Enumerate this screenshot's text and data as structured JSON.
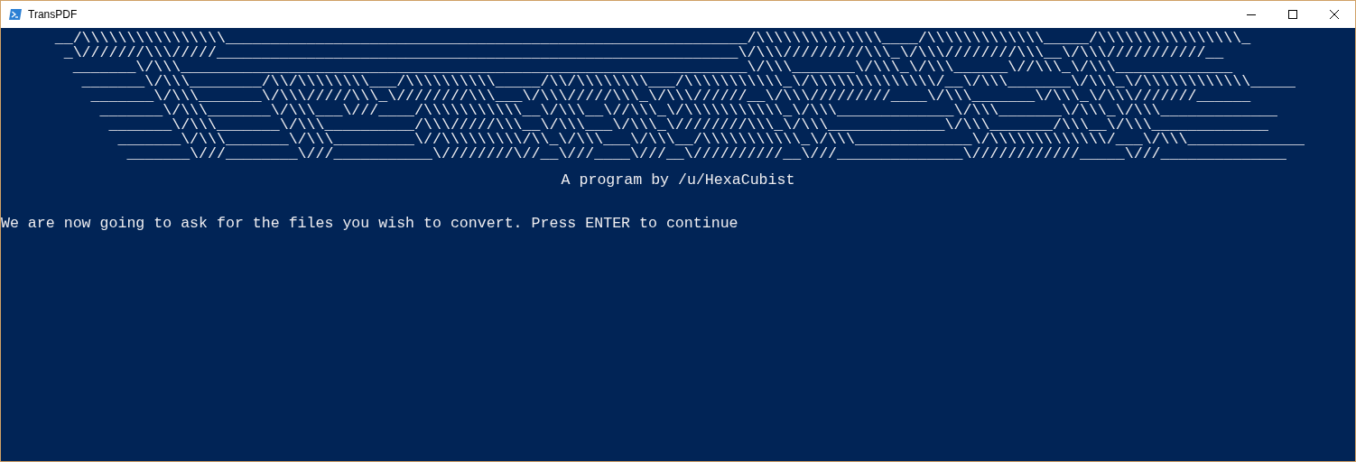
{
  "window": {
    "title": "TransPDF"
  },
  "art_lines": [
    "__/\\\\\\\\\\\\\\\\\\\\\\\\\\\\\\\\__________________________________________________________/\\\\\\\\\\\\\\\\\\\\\\\\\\\\____/\\\\\\\\\\\\\\\\\\\\\\\\\\_____/\\\\\\\\\\\\\\\\\\\\\\\\\\\\\\\\_",
    "_\\///////\\\\\\/////__________________________________________________________\\/\\\\\\/////////\\\\\\_\\/\\\\\\////////\\\\\\__\\/\\\\\\///////////__",
    "_______\\/\\\\\\_______________________________________________________________\\/\\\\\\_______\\/\\\\\\_\\/\\\\\\______\\//\\\\\\_\\/\\\\\\_____________",
    "_______\\/\\\\\\________/\\\\/\\\\\\\\\\\\\\\\___/\\\\\\\\\\\\\\\\\\\\_____/\\\\/\\\\\\\\\\\\\\\\___/\\\\\\\\\\\\\\\\\\\\\\_\\/\\\\\\\\\\\\\\\\\\\\\\\\\\\\/__\\/\\\\\\_______\\/\\\\\\_\\/\\\\\\\\\\\\\\\\\\\\\\\\_____",
    "_______\\/\\\\\\_______\\/\\\\\\/////\\\\\\_\\////////\\\\\\___\\/\\\\\\/////\\\\\\_\\/\\\\\\//////__\\/\\\\\\/////////____\\/\\\\\\_______\\/\\\\\\_\\/\\\\\\///////______",
    "_______\\/\\\\\\_______\\/\\\\\\___\\///____/\\\\\\\\\\\\\\\\\\\\\\__\\/\\\\\\__\\//\\\\\\_\\/\\\\\\\\\\\\\\\\\\\\\\_\\/\\\\\\_____________\\/\\\\\\_______\\/\\\\\\_\\/\\\\\\_____________",
    "_______\\/\\\\\\_______\\/\\\\\\__________/\\\\\\/////\\\\\\__\\/\\\\\\___\\/\\\\\\_\\////////\\\\\\_\\/\\\\\\_____________\\/\\\\\\_______/\\\\\\__\\/\\\\\\_____________",
    "_______\\/\\\\\\_______\\/\\\\\\_________\\//\\\\\\\\\\\\\\\\\\/\\\\_\\/\\\\\\___\\/\\\\\\__/\\\\\\\\\\\\\\\\\\\\\\_\\/\\\\\\_____________\\/\\\\\\\\\\\\\\\\\\\\\\\\\\/___\\/\\\\\\_____________",
    "_______\\///________\\///___________\\////////\\//__\\///____\\///__\\//////////__\\///______________\\////////////_____\\///______________"
  ],
  "subtitle": "A program by /u/HexaCubist",
  "message": "We are now going to ask for the files you wish to convert. Press ENTER to continue"
}
